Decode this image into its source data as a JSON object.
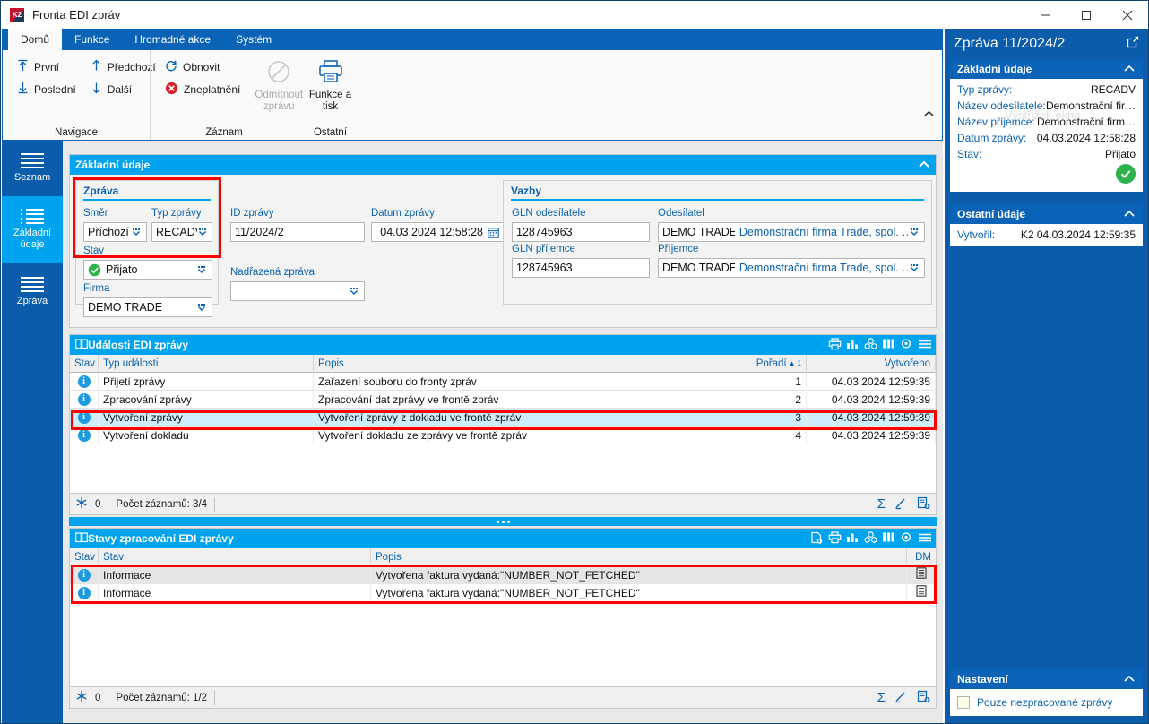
{
  "window": {
    "title": "Fronta EDI zpráv",
    "logo_text": "K2",
    "minimize": "—",
    "maximize": "□",
    "close": "✕"
  },
  "ribbon": {
    "tabs": [
      {
        "label": "Domů",
        "active": true
      },
      {
        "label": "Funkce",
        "active": false
      },
      {
        "label": "Hromadné akce",
        "active": false
      },
      {
        "label": "Systém",
        "active": false
      }
    ],
    "groups": [
      {
        "label": "Navigace",
        "items": [
          {
            "label": "První",
            "icon": "arrow-up-to-line-icon",
            "disabled": false
          },
          {
            "label": "Poslední",
            "icon": "arrow-down-to-line-icon",
            "disabled": false
          },
          {
            "label": "Předchozí",
            "icon": "arrow-up-icon",
            "disabled": false
          },
          {
            "label": "Další",
            "icon": "arrow-down-icon",
            "disabled": false
          }
        ]
      },
      {
        "label": "Záznam",
        "items": [
          {
            "label": "Obnovit",
            "icon": "refresh-icon",
            "disabled": false
          },
          {
            "label": "Zneplatnění",
            "icon": "cancel-circle-icon",
            "disabled": false
          },
          {
            "label": "Odmítnout zprávu",
            "icon": "forbidden-icon",
            "disabled": true
          }
        ]
      },
      {
        "label": "Ostatní",
        "items": [
          {
            "label": "Funkce a tisk",
            "icon": "printer-icon",
            "disabled": false
          }
        ]
      }
    ],
    "collapse_icon": "chevron-up-icon"
  },
  "leftnav": {
    "items": [
      {
        "label": "Seznam",
        "icon": "list-icon",
        "active": false
      },
      {
        "label": "Základní údaje",
        "icon": "details-list-icon",
        "active": true
      },
      {
        "label": "Zpráva",
        "icon": "list-icon",
        "active": false
      }
    ]
  },
  "basic_panel": {
    "title": "Základní údaje",
    "collapse_icon": "chevron-up-icon",
    "message_group": {
      "title": "Zpráva",
      "fields": {
        "smer_label": "Směr",
        "smer_value": "Příchozí",
        "typ_label": "Typ zprávy",
        "typ_value": "RECADV",
        "stav_label": "Stav",
        "stav_value": "Přijato",
        "firma_label": "Firma",
        "firma_value": "DEMO TRADE"
      }
    },
    "id_label": "ID zprávy",
    "id_value": "11/2024/2",
    "date_label": "Datum zprávy",
    "date_value": "04.03.2024 12:58:28",
    "parent_label": "Nadřazená zpráva",
    "parent_value": "",
    "links_group": {
      "title": "Vazby",
      "gln_sender_label": "GLN odesílatele",
      "gln_sender_value": "128745963",
      "sender_label": "Odesílatel",
      "sender_code": "DEMO TRADE",
      "sender_name": "Demonstrační firma Trade, spol. …",
      "gln_receiver_label": "GLN příjemce",
      "gln_receiver_value": "128745963",
      "receiver_label": "Příjemce",
      "receiver_code": "DEMO TRADE",
      "receiver_name": "Demonstrační firma Trade, spol. …"
    }
  },
  "events_grid": {
    "title": "Události EDI zprávy",
    "book_icon": "book-icon",
    "tools": [
      "print-icon",
      "chart-icon",
      "pivot-icon",
      "columns-icon",
      "settings-icon",
      "menu-icon"
    ],
    "columns": [
      "Stav",
      "Typ události",
      "Popis",
      "Pořadí",
      "Vytvořeno"
    ],
    "sort_column": "Pořadí",
    "sort_indicator": "▲",
    "sort_order": "1",
    "rows": [
      {
        "stav": "info",
        "typ": "Přijetí zprávy",
        "popis": "Zařazení souboru do fronty zpráv",
        "poradi": "1",
        "vytvoreno": "04.03.2024 12:59:35",
        "selected": false
      },
      {
        "stav": "info",
        "typ": "Zpracování zprávy",
        "popis": "Zpracování dat zprávy ve frontě zpráv",
        "poradi": "2",
        "vytvoreno": "04.03.2024 12:59:39",
        "selected": false
      },
      {
        "stav": "info",
        "typ": "Vytvoření zprávy",
        "popis": "Vytvoření zprávy z dokladu ve frontě zpráv",
        "poradi": "3",
        "vytvoreno": "04.03.2024 12:59:39",
        "selected": true
      },
      {
        "stav": "info",
        "typ": "Vytvoření dokladu",
        "popis": "Vytvoření dokladu ze zprávy ve frontě zpráv",
        "poradi": "4",
        "vytvoreno": "04.03.2024 12:59:39",
        "selected": false
      }
    ],
    "footer": {
      "filter_icon": "filter-icon",
      "filter_count": "0",
      "count_label": "Počet záznamů: 3/4",
      "right_icons": [
        "sum-icon",
        "edit-icon",
        "copy-icon"
      ]
    }
  },
  "states_grid": {
    "title": "Stavy zpracování EDI zprávy",
    "book_icon": "book-icon",
    "tools": [
      "preview-icon",
      "print-icon",
      "chart-icon",
      "pivot-icon",
      "columns-icon",
      "settings-icon",
      "menu-icon"
    ],
    "columns": [
      "Stav",
      "Stav",
      "Popis",
      "DM"
    ],
    "rows": [
      {
        "icon": "info",
        "stav": "Informace",
        "popis": "Vytvořena faktura vydaná:\"NUMBER_NOT_FETCHED\"",
        "dm": "doc-icon",
        "alt": true
      },
      {
        "icon": "info",
        "stav": "Informace",
        "popis": "Vytvořena faktura vydaná:\"NUMBER_NOT_FETCHED\"",
        "dm": "doc-icon",
        "alt": false
      }
    ],
    "footer": {
      "filter_icon": "filter-icon",
      "filter_count": "0",
      "count_label": "Počet záznamů: 1/2",
      "right_icons": [
        "sum-icon",
        "edit-icon",
        "copy-icon"
      ]
    }
  },
  "right_panel": {
    "title": "Zpráva 11/2024/2",
    "expand_icon": "external-link-icon",
    "sections": [
      {
        "title": "Základní údaje",
        "collapse_icon": "chevron-up-icon",
        "rows": [
          {
            "key": "Typ zprávy:",
            "value": "RECADV"
          },
          {
            "key": "Název odesílatele:",
            "value": "Demonstrační fir…"
          },
          {
            "key": "Název příjemce:",
            "value": "Demonstrační firm…"
          },
          {
            "key": "Datum zprávy:",
            "value": "04.03.2024 12:58:28"
          },
          {
            "key": "Stav:",
            "value": "Přijato"
          }
        ],
        "status_icon": "check-circle-icon"
      },
      {
        "title": "Ostatní údaje",
        "collapse_icon": "chevron-up-icon",
        "rows": [
          {
            "key": "Vytvořil:",
            "value": "K2 04.03.2024 12:59:35"
          }
        ]
      }
    ],
    "settings": {
      "title": "Nastavení",
      "collapse_icon": "chevron-up-icon",
      "checkbox_label": "Pouze nezpracované zprávy",
      "checkbox_checked": false
    },
    "watermark": "Výstřižek okna"
  },
  "colors": {
    "accent": "#00a3ee",
    "brand": "#0b5cab",
    "ribbon": "#0b63b8",
    "highlight": "#ff0000",
    "selection": "#cdeefc",
    "status_ok": "#2cb34a"
  }
}
